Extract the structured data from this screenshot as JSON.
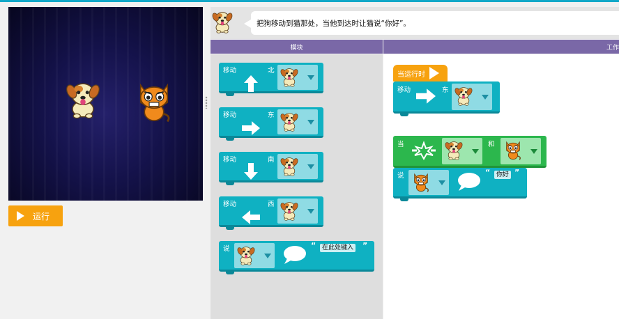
{
  "stage": {
    "run_label": "运行",
    "sprites": [
      "dog-sprite",
      "cat-sprite"
    ]
  },
  "instructions": {
    "text": "把狗移动到猫那处，当他到达时让猫说“你好”。"
  },
  "headers": {
    "toolbox": "模块",
    "workspace": "工作"
  },
  "toolbox": {
    "blocks": [
      {
        "label": "移动",
        "direction": "北",
        "arrow": "up-arrow-icon",
        "sprite": "dog"
      },
      {
        "label": "移动",
        "direction": "东",
        "arrow": "right-arrow-icon",
        "sprite": "dog"
      },
      {
        "label": "移动",
        "direction": "南",
        "arrow": "down-arrow-icon",
        "sprite": "dog"
      },
      {
        "label": "移动",
        "direction": "西",
        "arrow": "left-arrow-icon",
        "sprite": "dog"
      },
      {
        "label": "说",
        "sprite": "dog",
        "text": "在此处键入",
        "quote_open": "“",
        "quote_close": "”"
      }
    ]
  },
  "workspace": {
    "when_run": "当运行时",
    "move_label": "移动",
    "move_direction": "东",
    "when_label": "当",
    "and_label": "和",
    "say_label": "说",
    "say_text": "你好",
    "quote_open": "“",
    "quote_close": "”"
  },
  "colors": {
    "accent": "#0fb1c2",
    "header": "#7a68a7",
    "run": "#f7a20f",
    "event": "#2cb74d"
  }
}
